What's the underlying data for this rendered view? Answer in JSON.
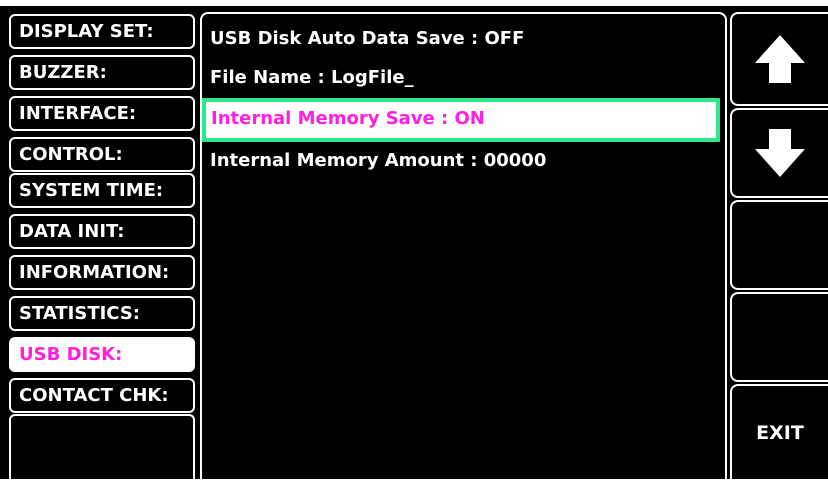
{
  "menu": {
    "items": [
      {
        "label": "DISPLAY SET:"
      },
      {
        "label": "BUZZER:"
      },
      {
        "label": "INTERFACE:"
      },
      {
        "label": "CONTROL:"
      },
      {
        "label": "SYSTEM TIME:"
      },
      {
        "label": "DATA INIT:"
      },
      {
        "label": "INFORMATION:"
      },
      {
        "label": "STATISTICS:"
      },
      {
        "label": "USB DISK:"
      },
      {
        "label": "CONTACT CHK:"
      }
    ],
    "selected": "USB DISK:"
  },
  "settings": {
    "rows": [
      {
        "label": "USB Disk Auto Data Save : OFF"
      },
      {
        "label": "File Name : LogFile_"
      },
      {
        "label": "Internal Memory Save : ON"
      },
      {
        "label": "Internal Memory Amount : 00000"
      }
    ],
    "highlighted": "Internal Memory Save : ON"
  },
  "softkeys": {
    "up_icon": "arrow-up-icon",
    "down_icon": "arrow-down-icon",
    "exit_label": "EXIT"
  },
  "colors": {
    "background": "#000000",
    "foreground": "#ffffff",
    "selected_text": "#ff1fe0",
    "highlight_border": "#2be88a"
  }
}
